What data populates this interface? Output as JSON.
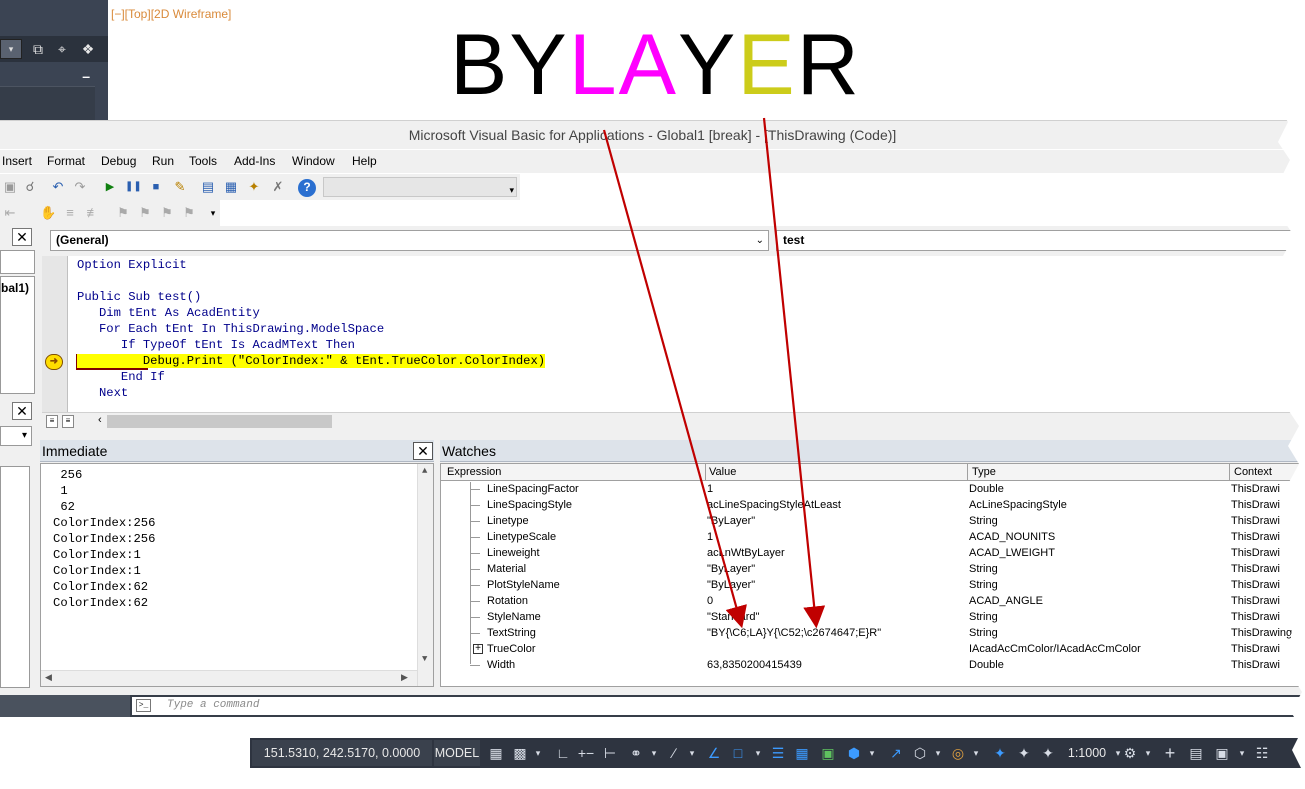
{
  "viewport_label": "[−][Top][2D Wireframe]",
  "headline": {
    "letters": [
      {
        "ch": "B",
        "color": "#000000"
      },
      {
        "ch": "Y",
        "color": "#000000"
      },
      {
        "ch": "L",
        "color": "#ff00ff"
      },
      {
        "ch": "A",
        "color": "#ff00ff"
      },
      {
        "ch": "Y",
        "color": "#000000"
      },
      {
        "ch": "E",
        "color": "#cccc1a"
      },
      {
        "ch": "R",
        "color": "#000000"
      }
    ]
  },
  "vba": {
    "title": "Microsoft Visual Basic for Applications - Global1 [break] - [ThisDrawing (Code)]",
    "menu": [
      "Insert",
      "Format",
      "Debug",
      "Run",
      "Tools",
      "Add-Ins",
      "Window",
      "Help"
    ],
    "project_tree_item": "bal1)",
    "combo_object": "(General)",
    "combo_procedure": "test",
    "code_lines": [
      "Option Explicit",
      "",
      "Public Sub test()",
      "   Dim tEnt As AcadEntity",
      "   For Each tEnt In ThisDrawing.ModelSpace",
      "      If TypeOf tEnt Is AcadMText Then",
      "         Debug.Print (\"ColorIndex:\" & tEnt.TrueColor.ColorIndex)",
      "      End If",
      "   Next"
    ],
    "current_line_index": 6
  },
  "immediate": {
    "title": "Immediate",
    "lines": [
      " 256",
      " 1",
      " 62",
      "ColorIndex:256",
      "ColorIndex:256",
      "ColorIndex:1",
      "ColorIndex:1",
      "ColorIndex:62",
      "ColorIndex:62"
    ]
  },
  "watches": {
    "title": "Watches",
    "columns": [
      "Expression",
      "Value",
      "Type",
      "Context"
    ],
    "rows": [
      {
        "expr": "LineSpacingFactor",
        "value": "1",
        "type": "Double",
        "context": "ThisDrawi"
      },
      {
        "expr": "LineSpacingStyle",
        "value": "acLineSpacingStyleAtLeast",
        "type": "AcLineSpacingStyle",
        "context": "ThisDrawi"
      },
      {
        "expr": "Linetype",
        "value": "\"ByLayer\"",
        "type": "String",
        "context": "ThisDrawi"
      },
      {
        "expr": "LinetypeScale",
        "value": "1",
        "type": "ACAD_NOUNITS",
        "context": "ThisDrawi"
      },
      {
        "expr": "Lineweight",
        "value": "acLnWtByLayer",
        "type": "ACAD_LWEIGHT",
        "context": "ThisDrawi"
      },
      {
        "expr": "Material",
        "value": "\"ByLayer\"",
        "type": "String",
        "context": "ThisDrawi"
      },
      {
        "expr": "PlotStyleName",
        "value": "\"ByLayer\"",
        "type": "String",
        "context": "ThisDrawi"
      },
      {
        "expr": "Rotation",
        "value": "0",
        "type": "ACAD_ANGLE",
        "context": "ThisDrawi"
      },
      {
        "expr": "StyleName",
        "value": "\"Standard\"",
        "type": "String",
        "context": "ThisDrawi"
      },
      {
        "expr": "TextString",
        "value": "\"BY{\\C6;LA}Y{\\C52;\\c2674647;E}R\"",
        "type": "String",
        "context": "ThisDrawing"
      },
      {
        "expr": "TrueColor",
        "value": "",
        "type": "IAcadAcCmColor/IAcadAcCmColor",
        "context": "ThisDrawi"
      },
      {
        "expr": "Width",
        "value": "63,8350200415439",
        "type": "Double",
        "context": "ThisDrawi"
      }
    ]
  },
  "command_line": {
    "placeholder": "Type a command"
  },
  "status": {
    "coords": "151.5310, 242.5170, 0.0000",
    "model": "MODEL",
    "scale": "1:1000"
  },
  "colors": {
    "annotation_arrow": "#c00000",
    "breakpoint": "#800000",
    "exec_highlight": "#ffff00"
  }
}
